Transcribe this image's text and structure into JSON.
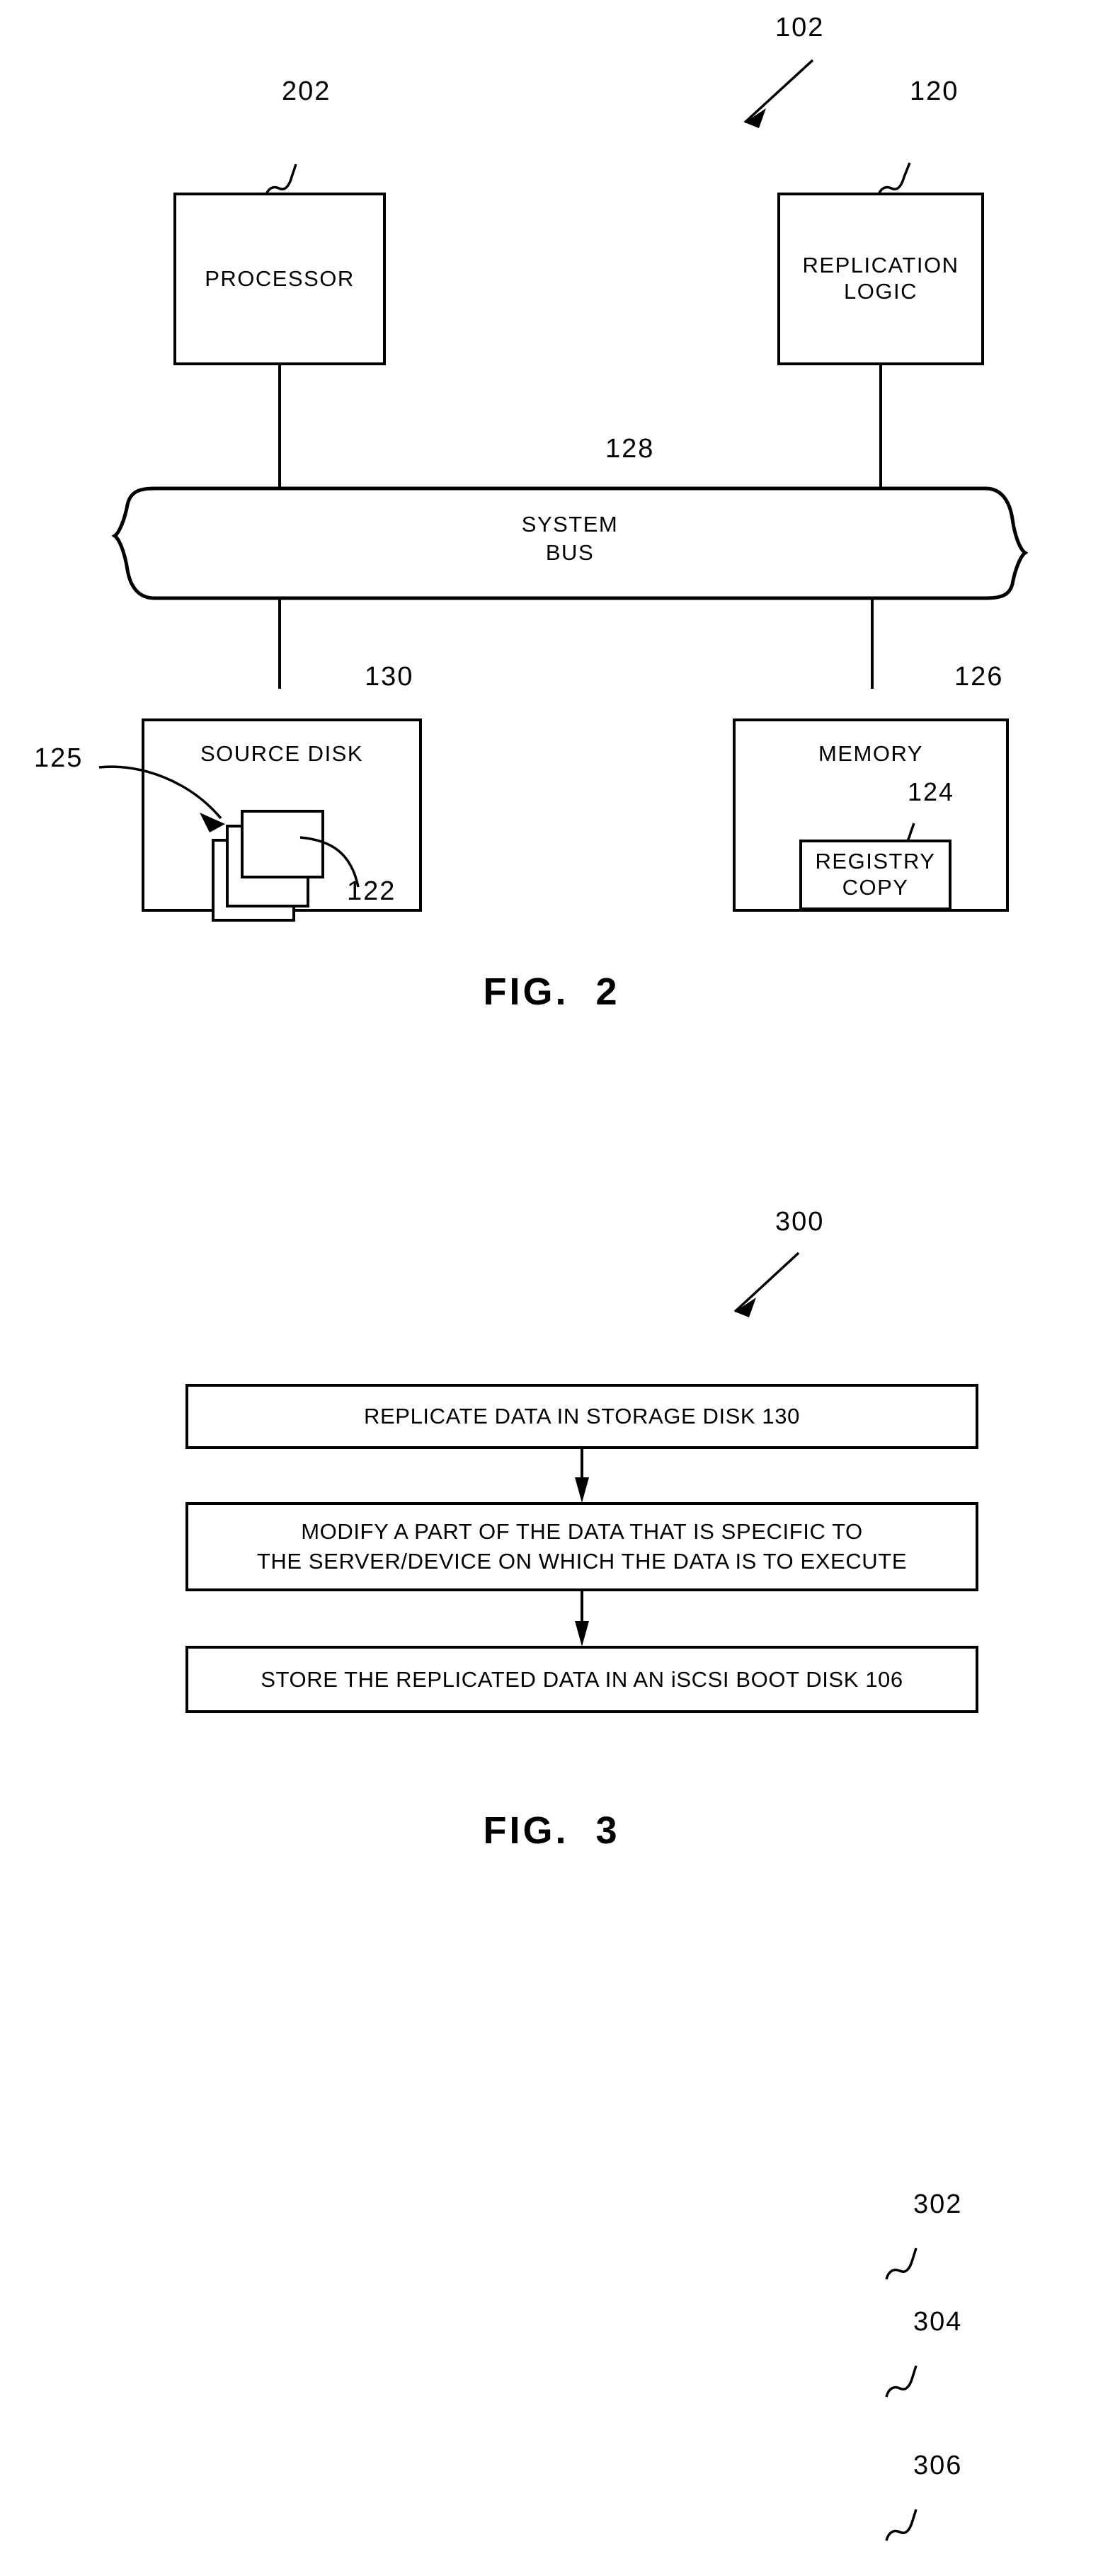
{
  "figure2": {
    "caption": "FIG.  2",
    "system_ref": "102",
    "blocks": [
      {
        "ref": "202",
        "label": "PROCESSOR"
      },
      {
        "ref": "120",
        "label": "REPLICATION\nLOGIC"
      },
      {
        "ref": "128",
        "label": "SYSTEM\nBUS"
      },
      {
        "ref": "130",
        "label": "SOURCE  DISK"
      },
      {
        "ref": "126",
        "label": "MEMORY"
      },
      {
        "ref": "124",
        "label": "REGISTRY\nCOPY"
      }
    ],
    "processor": {
      "ref": "202",
      "label": "PROCESSOR"
    },
    "replication_logic": {
      "ref": "120",
      "label": "REPLICATION\nLOGIC"
    },
    "system_bus": {
      "ref": "128",
      "label": "SYSTEM\nBUS"
    },
    "source_disk": {
      "ref": "130",
      "label": "SOURCE  DISK"
    },
    "memory": {
      "ref": "126",
      "label": "MEMORY"
    },
    "registry_copy": {
      "ref": "124",
      "label": "REGISTRY\nCOPY"
    },
    "data_stack_ref": "122",
    "data_pointer_ref": "125"
  },
  "figure3": {
    "caption": "FIG.  3",
    "process_ref": "300",
    "steps": [
      {
        "ref": "302",
        "text": "REPLICATE  DATA  IN  STORAGE  DISK  130"
      },
      {
        "ref": "304",
        "text": "MODIFY  A  PART  OF  THE  DATA  THAT  IS  SPECIFIC  TO\nTHE  SERVER/DEVICE  ON  WHICH  THE  DATA  IS  TO  EXECUTE"
      },
      {
        "ref": "306",
        "text": "STORE  THE  REPLICATED  DATA  IN  AN  iSCSI  BOOT  DISK  106"
      }
    ]
  },
  "colors": {
    "ink": "#000000",
    "paper": "#ffffff"
  }
}
